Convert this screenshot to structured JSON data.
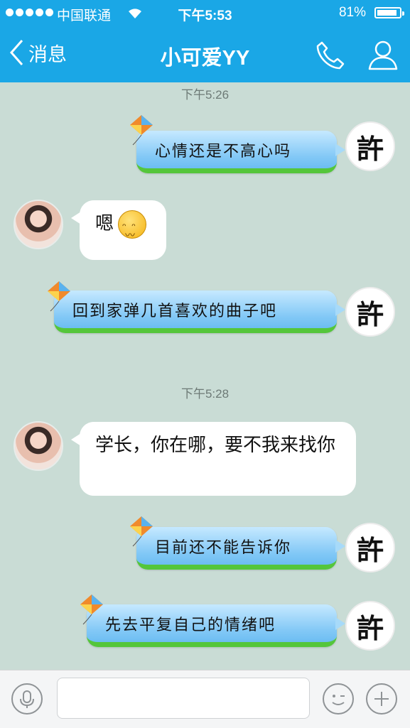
{
  "status_bar": {
    "carrier": "中国联通",
    "time": "下午5:53",
    "battery": "81%",
    "battery_level": 0.81
  },
  "nav": {
    "back_label": "消息",
    "title": "小可爱YY"
  },
  "messages": [
    {
      "timestamp": "下午5:26"
    },
    {
      "from": "me",
      "text": "心情还是不高心吗"
    },
    {
      "from": "other",
      "text": "嗯"
    },
    {
      "from": "me",
      "text": "回到家弹几首喜欢的曲子吧"
    },
    {
      "timestamp": "下午5:28"
    },
    {
      "from": "other",
      "text": "学长，你在哪，要不我来找你"
    },
    {
      "from": "me",
      "text": "目前还不能告诉你"
    },
    {
      "from": "me",
      "text": "先去平复自己的情绪吧"
    }
  ],
  "seal_char": "許",
  "input": {
    "value": "",
    "placeholder": ""
  },
  "colors": {
    "nav_bg": "#1aa7e6",
    "chat_bg": "#c9dcd5",
    "bubble_blue": "#82c8f6",
    "grass": "#54c63b"
  }
}
